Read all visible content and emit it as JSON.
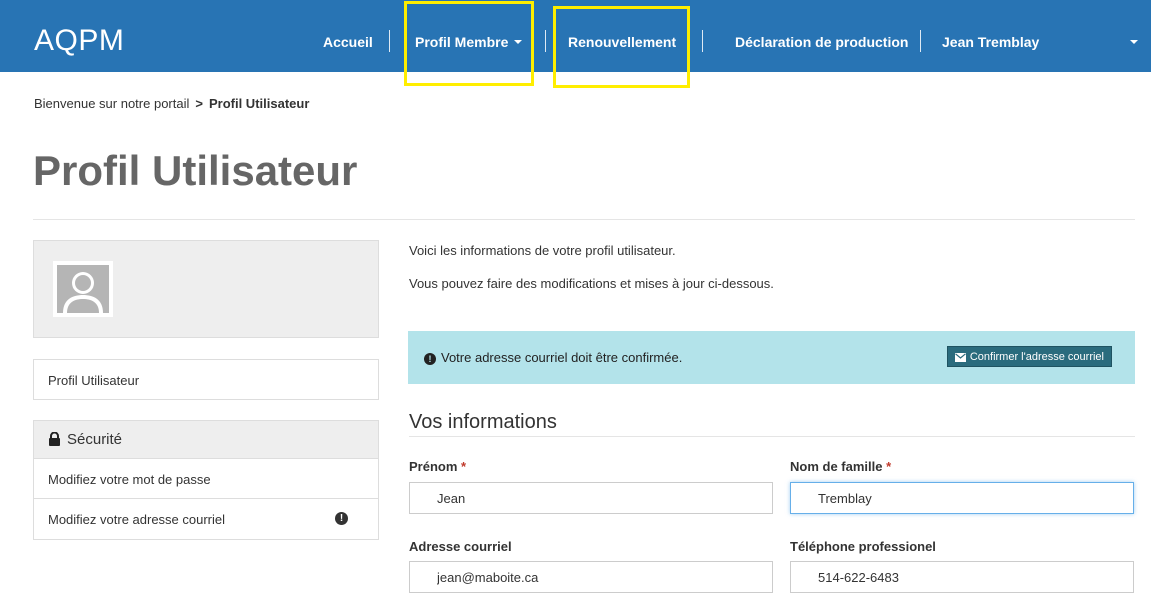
{
  "header": {
    "brand": "AQPM",
    "nav": {
      "accueil": "Accueil",
      "profil_membre": "Profil Membre",
      "renouvellement": "Renouvellement",
      "declaration": "Déclaration de production",
      "user": "Jean Tremblay"
    }
  },
  "breadcrumb": {
    "home": "Bienvenue sur notre portail",
    "separator": ">",
    "current": "Profil Utilisateur"
  },
  "page": {
    "title": "Profil Utilisateur"
  },
  "sidebar": {
    "profile_link": "Profil Utilisateur",
    "security": {
      "heading": "Sécurité",
      "items": [
        {
          "label": "Modifiez votre mot de passe"
        },
        {
          "label": "Modifiez votre adresse courriel",
          "badge": "!"
        }
      ]
    }
  },
  "main": {
    "intro_1": "Voici les informations de votre profil utilisateur.",
    "intro_2": "Vous pouvez faire des modifications et mises à jour ci-dessous.",
    "alert": {
      "icon": "!",
      "text": "Votre adresse courriel doit être confirmée.",
      "button": "Confirmer l'adresse courriel"
    },
    "section_title": "Vos informations",
    "fields": {
      "prenom": {
        "label": "Prénom",
        "required": "*",
        "value": "Jean"
      },
      "nom": {
        "label": "Nom de famille",
        "required": "*",
        "value": "Tremblay"
      },
      "courriel": {
        "label": "Adresse courriel",
        "value": "jean@maboite.ca"
      },
      "telephone": {
        "label": "Téléphone professionel",
        "value": "514-622-6483"
      }
    }
  },
  "colors": {
    "navbar": "#2874b4",
    "alert_bg": "#b3e3ea",
    "confirm_button": "#2a6b7d",
    "highlight": "#ffee00",
    "required": "#c0392b"
  },
  "icons": [
    "caret-down-icon",
    "user-placeholder-icon",
    "lock-icon",
    "exclamation-circle-icon",
    "envelope-icon"
  ]
}
